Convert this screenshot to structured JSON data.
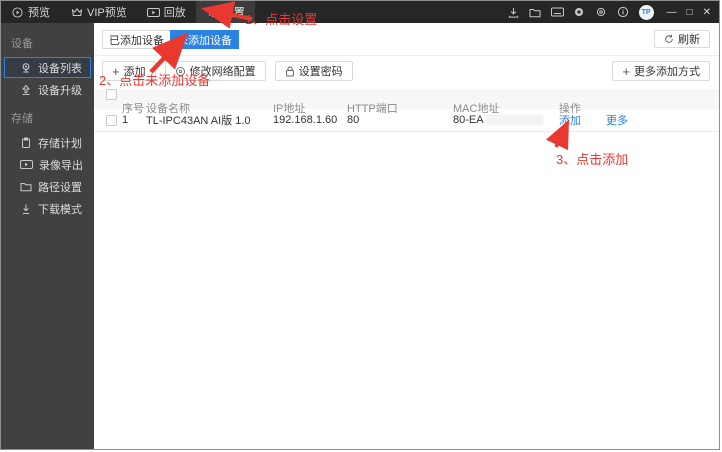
{
  "titlebar": {
    "tabs": [
      {
        "label": "预览",
        "icon": "play-circle"
      },
      {
        "label": "VIP预览",
        "icon": "crown"
      },
      {
        "label": "回放",
        "icon": "playback"
      },
      {
        "label": "设置",
        "icon": "gear",
        "active": true
      }
    ],
    "avatar": "TP",
    "window_controls": {
      "minimize": "—",
      "maximize": "□",
      "close": "✕"
    }
  },
  "sidebar": {
    "sections": [
      {
        "label": "设备",
        "items": [
          {
            "label": "设备列表",
            "icon": "camera",
            "active": true
          },
          {
            "label": "设备升级",
            "icon": "upgrade"
          }
        ]
      },
      {
        "label": "存储",
        "items": [
          {
            "label": "存储计划",
            "icon": "clipboard"
          },
          {
            "label": "录像导出",
            "icon": "video-export"
          },
          {
            "label": "路径设置",
            "icon": "folder"
          },
          {
            "label": "下载模式",
            "icon": "download"
          }
        ]
      }
    ]
  },
  "main": {
    "tabs": [
      {
        "label": "已添加设备"
      },
      {
        "label": "未添加设备",
        "active": true
      }
    ],
    "refresh_label": "刷新",
    "toolbar": {
      "add": "添加",
      "modify_network": "修改网络配置",
      "set_password": "设置密码",
      "more_ways": "更多添加方式"
    },
    "table": {
      "columns": [
        "序号",
        "设备名称",
        "IP地址",
        "HTTP端口",
        "MAC地址",
        "操作"
      ],
      "rows": [
        {
          "index": "1",
          "name": "TL-IPC43AN AI版 1.0",
          "ip": "192.168.1.60",
          "http_port": "80",
          "mac": "80-EA",
          "mac_blurred": true,
          "actions": [
            "添加",
            "更多"
          ]
        }
      ]
    }
  },
  "annotations": {
    "step1": "1、点击设置",
    "step2": "2、点击未添加设备",
    "step3": "3、点击添加"
  },
  "colors": {
    "accent": "#2a82e4",
    "annotation_red": "#e8382f",
    "titlebar_bg": "#262626",
    "sidebar_bg": "#414141"
  }
}
